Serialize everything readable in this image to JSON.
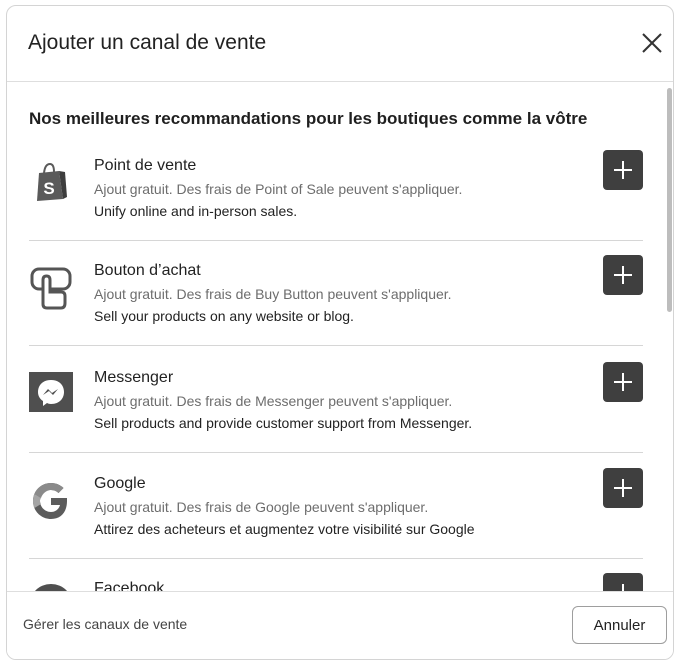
{
  "modal": {
    "title": "Ajouter un canal de vente",
    "section_title": "Nos meilleures recommandations pour les boutiques comme la vôtre"
  },
  "channels": [
    {
      "name": "Point de vente",
      "fee": "Ajout gratuit. Des frais de Point of Sale peuvent s'appliquer.",
      "description": "Unify online and in-person sales.",
      "icon": "shopify-bag-icon"
    },
    {
      "name": "Bouton d’achat",
      "fee": "Ajout gratuit. Des frais de Buy Button peuvent s'appliquer.",
      "description": "Sell your products on any website or blog.",
      "icon": "buy-button-icon"
    },
    {
      "name": "Messenger",
      "fee": "Ajout gratuit. Des frais de Messenger peuvent s'appliquer.",
      "description": "Sell products and provide customer support from Messenger.",
      "icon": "messenger-icon"
    },
    {
      "name": "Google",
      "fee": "Ajout gratuit. Des frais de Google peuvent s'appliquer.",
      "description": "Attirez des acheteurs et augmentez votre visibilité sur Google",
      "icon": "google-icon"
    },
    {
      "name": "Facebook",
      "icon": "facebook-icon"
    }
  ],
  "footer": {
    "manage_link": "Gérer les canaux de vente",
    "cancel_label": "Annuler"
  }
}
